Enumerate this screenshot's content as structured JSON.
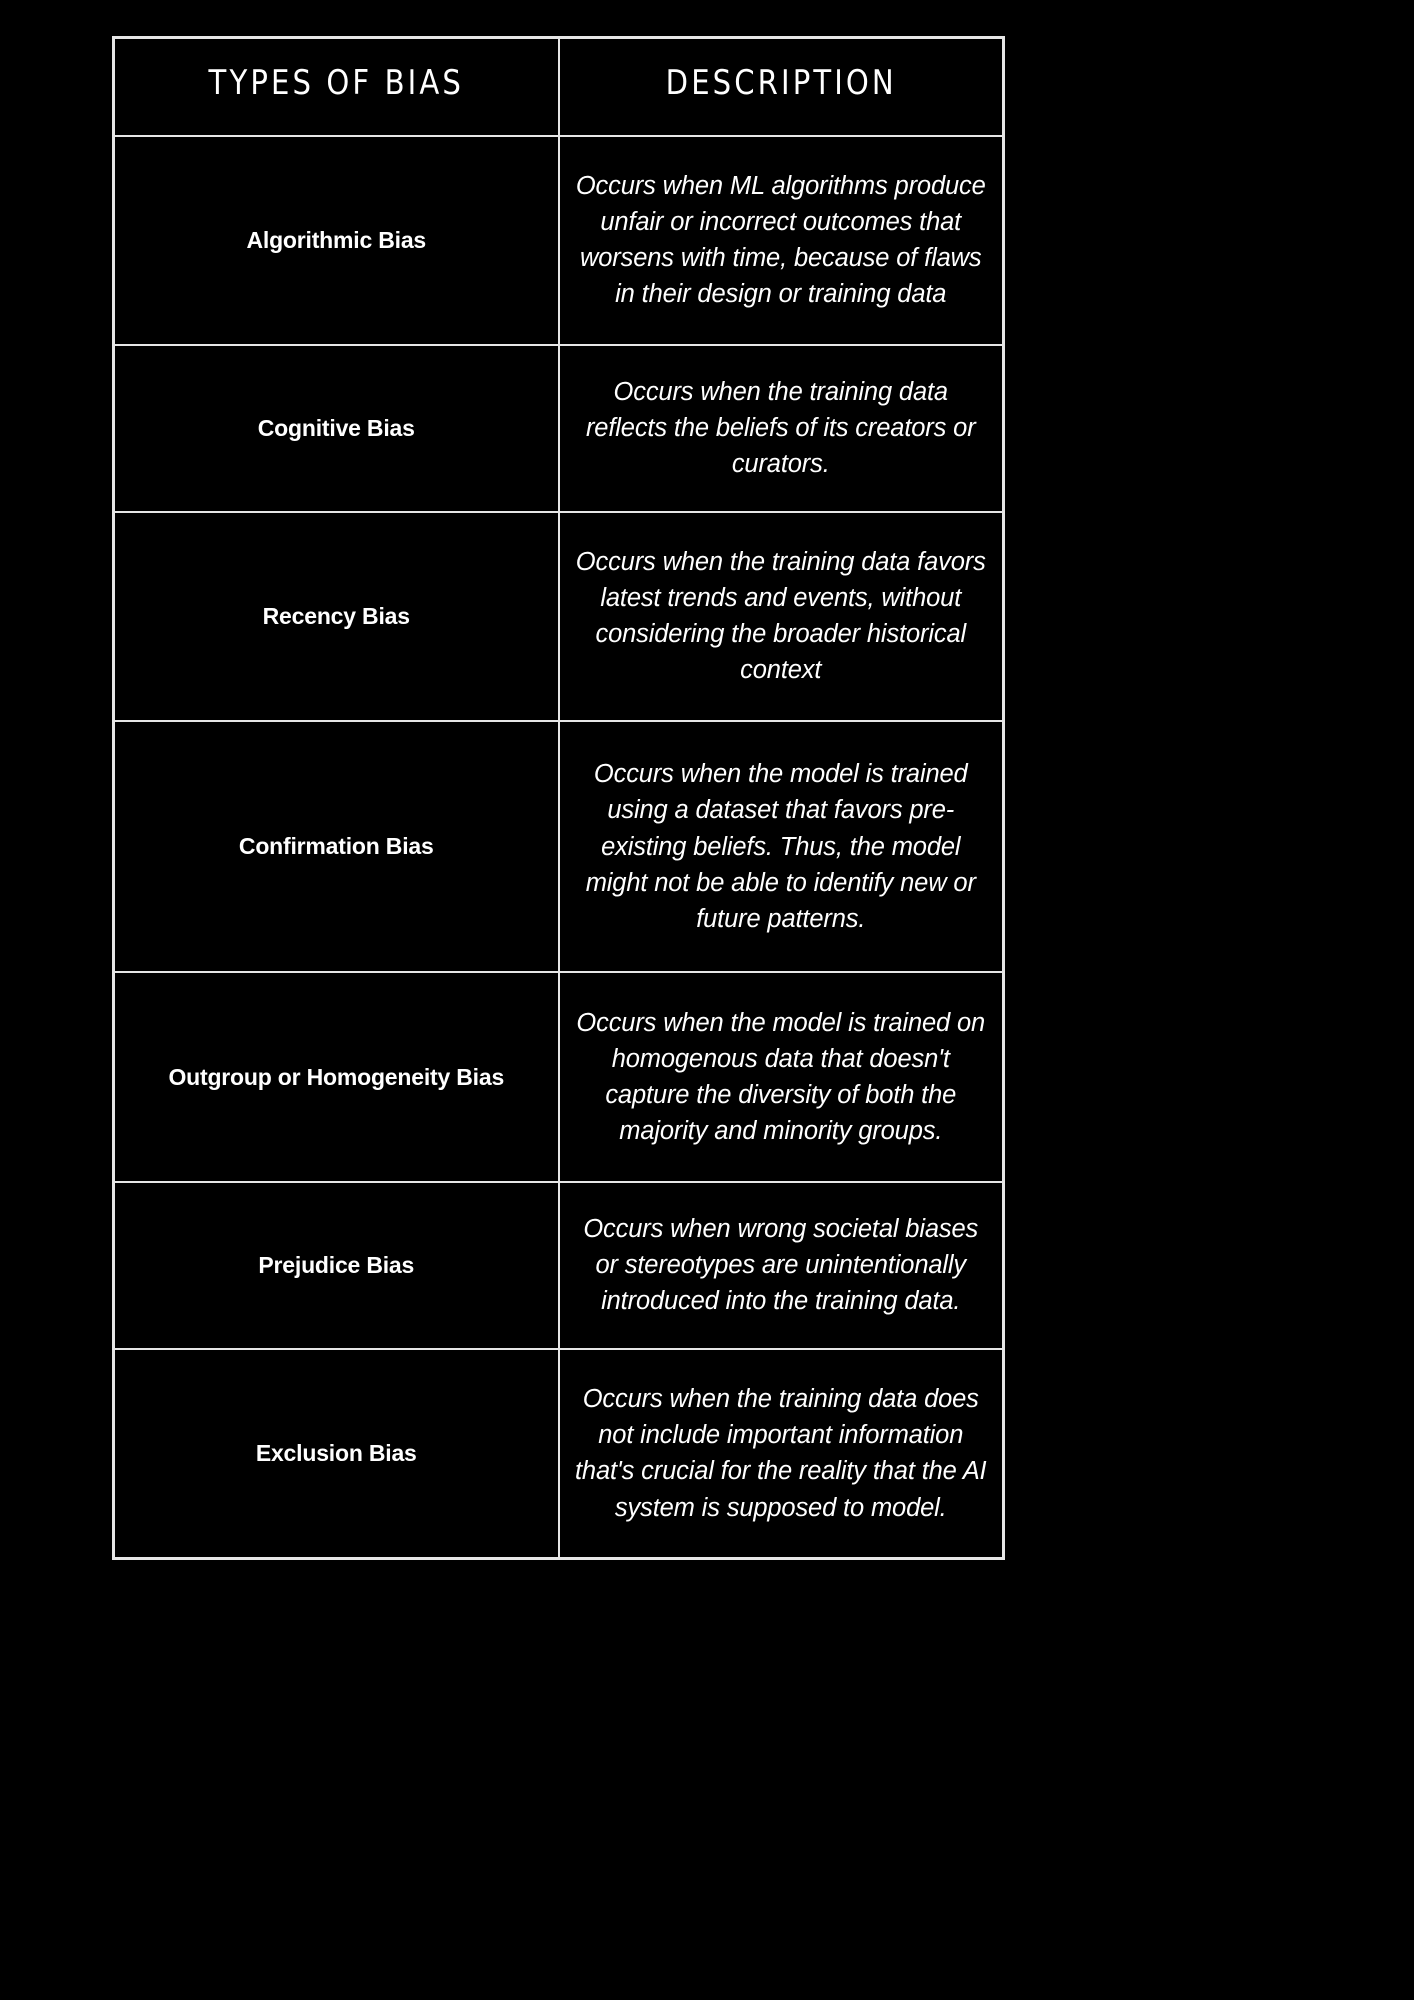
{
  "background_color": "#000000",
  "border_color": "#e6e6e6",
  "text_color": "#ffffff",
  "table": {
    "headers": {
      "type_label": "Types of Bias",
      "description_label": "Description"
    },
    "rows": [
      {
        "type": "Algorithmic Bias",
        "description": "Occurs when ML algorithms produce unfair or incorrect outcomes that worsens with time, because of flaws in their design or training data"
      },
      {
        "type": "Cognitive Bias",
        "description": "Occurs when the training data reflects the beliefs of its creators or curators."
      },
      {
        "type": "Recency Bias",
        "description": "Occurs when the training data favors latest trends and events, without considering the broader historical context"
      },
      {
        "type": "Confirmation Bias",
        "description": "Occurs when the model is trained using a dataset that favors pre-existing beliefs. Thus, the model might not be able to identify new or future patterns."
      },
      {
        "type": "Outgroup or Homogeneity Bias",
        "description": "Occurs when the model is trained on homogenous data that doesn't capture the diversity of both the majority and minority groups."
      },
      {
        "type": "Prejudice Bias",
        "description": "Occurs when wrong societal biases or stereotypes are unintentionally introduced into the training data."
      },
      {
        "type": "Exclusion Bias",
        "description": "Occurs when the training data does not include important information that's crucial for the reality that the AI system is supposed to model."
      }
    ]
  }
}
